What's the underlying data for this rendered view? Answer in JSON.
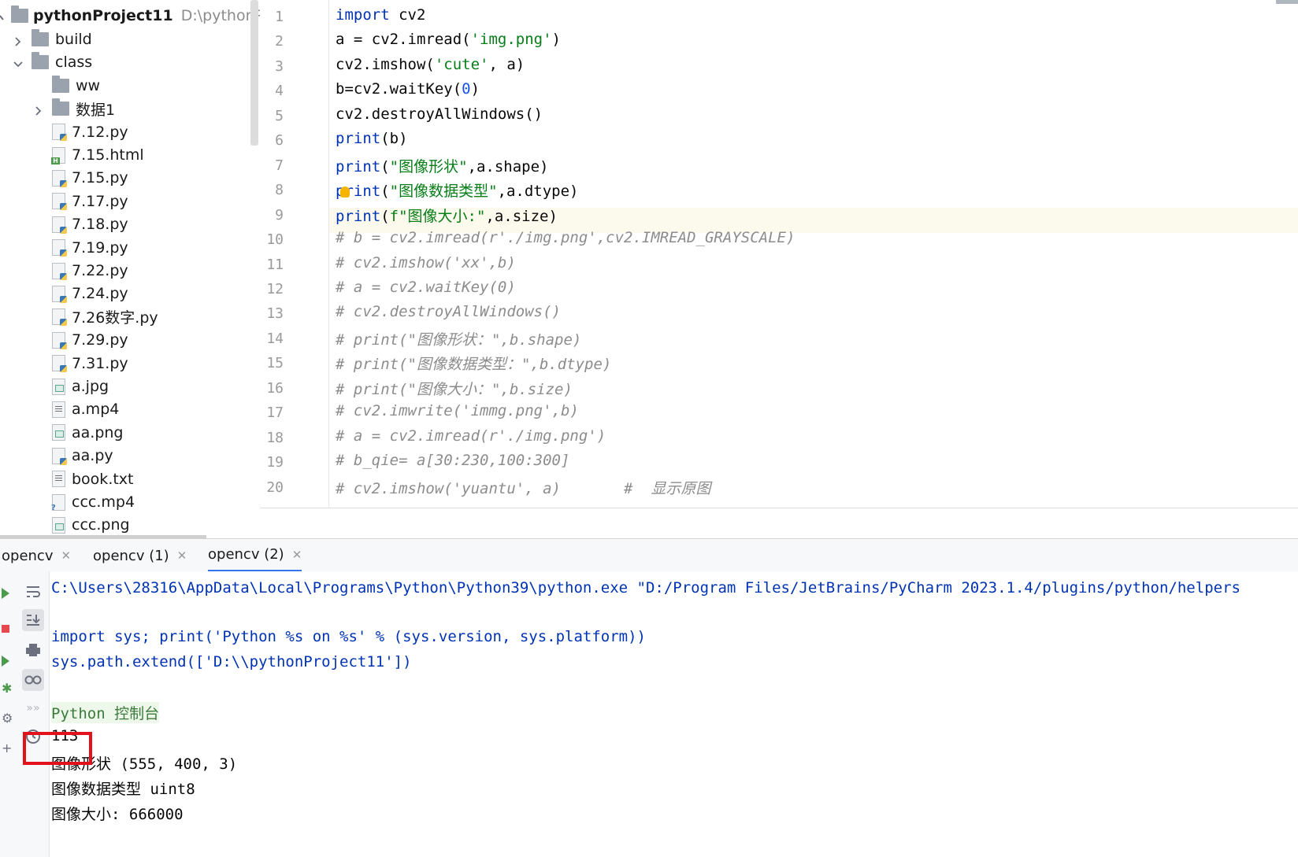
{
  "project_tree": {
    "root": {
      "name": "pythonProject11",
      "path": "D:\\pythonProjec"
    },
    "items": [
      {
        "label": "build",
        "type": "folder",
        "expandable": true,
        "expanded": false,
        "level": 1
      },
      {
        "label": "class",
        "type": "folder",
        "expandable": true,
        "expanded": true,
        "level": 1
      },
      {
        "label": "ww",
        "type": "folder",
        "expandable": false,
        "level": 2
      },
      {
        "label": "数据1",
        "type": "folder",
        "expandable": true,
        "expanded": false,
        "level": 2
      },
      {
        "label": "7.12.py",
        "type": "py",
        "level": 2
      },
      {
        "label": "7.15.html",
        "type": "html",
        "level": 2
      },
      {
        "label": "7.15.py",
        "type": "py",
        "level": 2
      },
      {
        "label": "7.17.py",
        "type": "py",
        "level": 2
      },
      {
        "label": "7.18.py",
        "type": "py",
        "level": 2
      },
      {
        "label": "7.19.py",
        "type": "py",
        "level": 2
      },
      {
        "label": "7.22.py",
        "type": "py",
        "level": 2
      },
      {
        "label": "7.24.py",
        "type": "py",
        "level": 2
      },
      {
        "label": "7.26数字.py",
        "type": "py",
        "level": 2
      },
      {
        "label": "7.29.py",
        "type": "py",
        "level": 2
      },
      {
        "label": "7.31.py",
        "type": "py",
        "level": 2
      },
      {
        "label": "a.jpg",
        "type": "img",
        "level": 2
      },
      {
        "label": "a.mp4",
        "type": "txt",
        "level": 2
      },
      {
        "label": "aa.png",
        "type": "img",
        "level": 2
      },
      {
        "label": "aa.py",
        "type": "py",
        "level": 2
      },
      {
        "label": "book.txt",
        "type": "txt",
        "level": 2
      },
      {
        "label": "ccc.mp4",
        "type": "unknown",
        "level": 2
      },
      {
        "label": "ccc.png",
        "type": "img",
        "level": 2
      }
    ]
  },
  "editor": {
    "current_line": 9,
    "line_numbers": [
      "1",
      "2",
      "3",
      "4",
      "5",
      "6",
      "7",
      "8",
      "9",
      "10",
      "11",
      "12",
      "13",
      "14",
      "15",
      "16",
      "17",
      "18",
      "19",
      "20"
    ],
    "lines": [
      "import cv2",
      "a = cv2.imread('img.png')",
      "cv2.imshow('cute', a)",
      "b=cv2.waitKey(0)",
      "cv2.destroyAllWindows()",
      "print(b)",
      "print(\"图像形状\",a.shape)",
      "print(\"图像数据类型\",a.dtype)",
      "print(f\"图像大小:\",a.size)",
      "# b = cv2.imread(r'./img.png',cv2.IMREAD_GRAYSCALE)",
      "# cv2.imshow('xx',b)",
      "# a = cv2.waitKey(0)",
      "# cv2.destroyAllWindows()",
      "# print(\"图像形状：\",b.shape)",
      "# print(\"图像数据类型：\",b.dtype)",
      "# print(\"图像大小：\",b.size)",
      "# cv2.imwrite('immg.png',b)",
      "# a = cv2.imread(r'./img.png')",
      "# b_qie= a[30:230,100:300]",
      "# cv2.imshow('yuantu', a)       #  显示原图"
    ]
  },
  "run_panel": {
    "tabs": [
      {
        "label": "opencv",
        "active": false
      },
      {
        "label": "opencv (1)",
        "active": false
      },
      {
        "label": "opencv (2)",
        "active": true
      }
    ],
    "toolbar_icons": [
      "soft-wrap-icon",
      "scroll-to-end-icon",
      "print-icon",
      "glasses-icon",
      "forward-icon",
      "history-icon"
    ],
    "console_lines": {
      "cmd": "C:\\Users\\28316\\AppData\\Local\\Programs\\Python\\Python39\\python.exe \"D:/Program Files/JetBrains/PyCharm 2023.1.4/plugins/python/helpers",
      "import_sys": "import sys; print('Python %s on %s' % (sys.version, sys.platform))",
      "sys_path": "sys.path.extend(['D:\\\\pythonProject11'])",
      "console_label": "Python 控制台",
      "out1": "113",
      "out2": "图像形状 (555, 400, 3)",
      "out3": "图像数据类型 uint8",
      "out4": "图像大小: 666000"
    }
  },
  "colors": {
    "keyword": "#0033b3",
    "string": "#067d17",
    "number": "#1750eb",
    "comment": "#8c8c8c",
    "highlight_box": "#e3111b",
    "current_line_bg": "#fcfaed"
  }
}
